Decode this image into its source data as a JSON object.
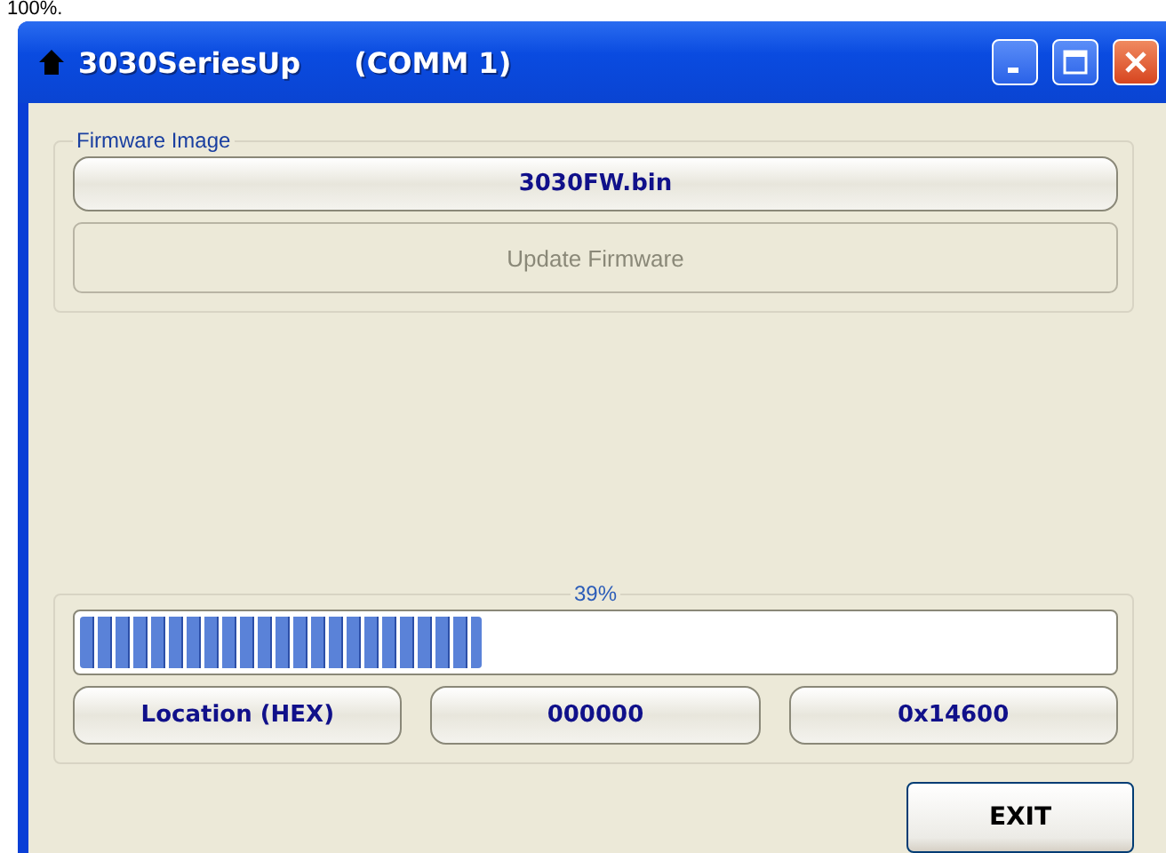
{
  "caption": "100%.",
  "window": {
    "title": "3030SeriesUp",
    "port": "(COMM 1)"
  },
  "firmware_group": {
    "label": "Firmware Image",
    "file_button": "3030FW.bin",
    "update_button": {
      "label": "Update Firmware",
      "disabled": true
    }
  },
  "progress_group": {
    "label": "39%",
    "level": 0.39
  },
  "location_fields": [
    "Location (HEX)",
    "000000",
    "0x14600"
  ],
  "exit_button": "EXIT"
}
